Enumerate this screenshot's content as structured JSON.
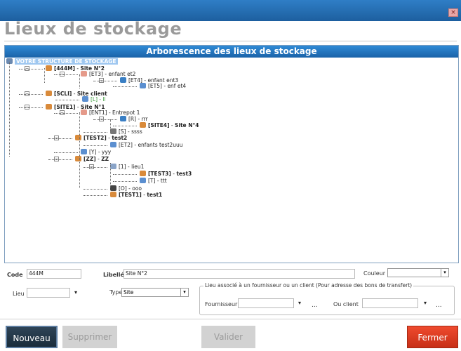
{
  "window": {
    "title": "Lieux de stockage",
    "close_glyph": "×"
  },
  "tree": {
    "header": "Arborescence des lieux de stockage",
    "root": "VOTRE STRUCTURE DE STOCKAGE",
    "nodes": [
      {
        "code": "[444M]",
        "sep": " - ",
        "name": "Site N°2",
        "icon": "site-icon",
        "bold": true
      },
      {
        "code": "[ET3]",
        "sep": " - ",
        "name": "enfant et2",
        "icon": "building-icon",
        "bold": false
      },
      {
        "code": "[ET4]",
        "sep": " - ",
        "name": "enfant ent3",
        "icon": "pie-icon",
        "bold": false
      },
      {
        "code": "[ET5]",
        "sep": " - ",
        "name": "enf et4",
        "icon": "shelf-icon",
        "bold": false
      },
      {
        "code": "[SCLI]",
        "sep": " - ",
        "name": "Site client",
        "icon": "site-icon",
        "bold": true
      },
      {
        "code": "[L]",
        "sep": " - ",
        "name": "ll",
        "icon": "shelf-icon",
        "bold": false,
        "color": "#3b9c3b"
      },
      {
        "code": "[SITE1]",
        "sep": " - ",
        "name": "Site N°1",
        "icon": "site-icon",
        "bold": true
      },
      {
        "code": "[ENT1]",
        "sep": " - ",
        "name": "Entrepot 1",
        "icon": "building-icon",
        "bold": false
      },
      {
        "code": "[R]",
        "sep": " - ",
        "name": "rrr",
        "icon": "pie-icon",
        "bold": false
      },
      {
        "code": "[SITE4]",
        "sep": " - ",
        "name": "Site N°4",
        "icon": "site-icon",
        "bold": true
      },
      {
        "code": "[S]",
        "sep": " - ",
        "name": "ssss",
        "icon": "column-icon",
        "bold": false
      },
      {
        "code": "[TEST2]",
        "sep": " - ",
        "name": "test2",
        "icon": "site-icon",
        "bold": true
      },
      {
        "code": "[ET2]",
        "sep": " - ",
        "name": "enfants test2uuu",
        "icon": "shelf-icon",
        "bold": false
      },
      {
        "code": "[Y]",
        "sep": " - ",
        "name": "yyy",
        "icon": "shelf-icon",
        "bold": false
      },
      {
        "code": "[ZZ]",
        "sep": " - ",
        "name": "ZZ",
        "icon": "site-icon",
        "bold": true
      },
      {
        "code": "[1]",
        "sep": " - ",
        "name": "lieu1",
        "icon": "list-icon",
        "bold": false
      },
      {
        "code": "[TEST3]",
        "sep": " - ",
        "name": "test3",
        "icon": "site-icon",
        "bold": true
      },
      {
        "code": "[T]",
        "sep": " - ",
        "name": "ttt",
        "icon": "shelf-icon",
        "bold": false
      },
      {
        "code": "[O]",
        "sep": " - ",
        "name": "ooo",
        "icon": "pillar-icon",
        "bold": false
      },
      {
        "code": "[TEST1]",
        "sep": " - ",
        "name": "test1",
        "icon": "site-icon",
        "bold": true
      }
    ]
  },
  "form": {
    "code_label": "Code",
    "code_value": "444M",
    "libelle_label": "Libellé",
    "libelle_value": "Site N°2",
    "couleur_label": "Couleur",
    "couleur_value": "",
    "lieu_label": "Lieu",
    "lieu_value": "",
    "type_label": "Type",
    "type_value": "Site",
    "group_legend": "Lieu associé à un fournisseur ou un client (Pour adresse des bons de transfert)",
    "fournisseur_label": "Fournisseur",
    "fournisseur_value": "",
    "client_label": "Ou client",
    "client_value": "",
    "dropdown_glyph": "▾",
    "browse_glyph": "..."
  },
  "buttons": {
    "nouveau": "Nouveau",
    "supprimer": "Supprimer",
    "valider": "Valider",
    "fermer": "Fermer"
  },
  "colors": {
    "title_bar": "#1d5f9f",
    "tree_header": "#1a62a8",
    "nouveau_bg": "#1a2c3b",
    "fermer_bg": "#d33a20",
    "disabled_bg": "#d2d2d2"
  }
}
